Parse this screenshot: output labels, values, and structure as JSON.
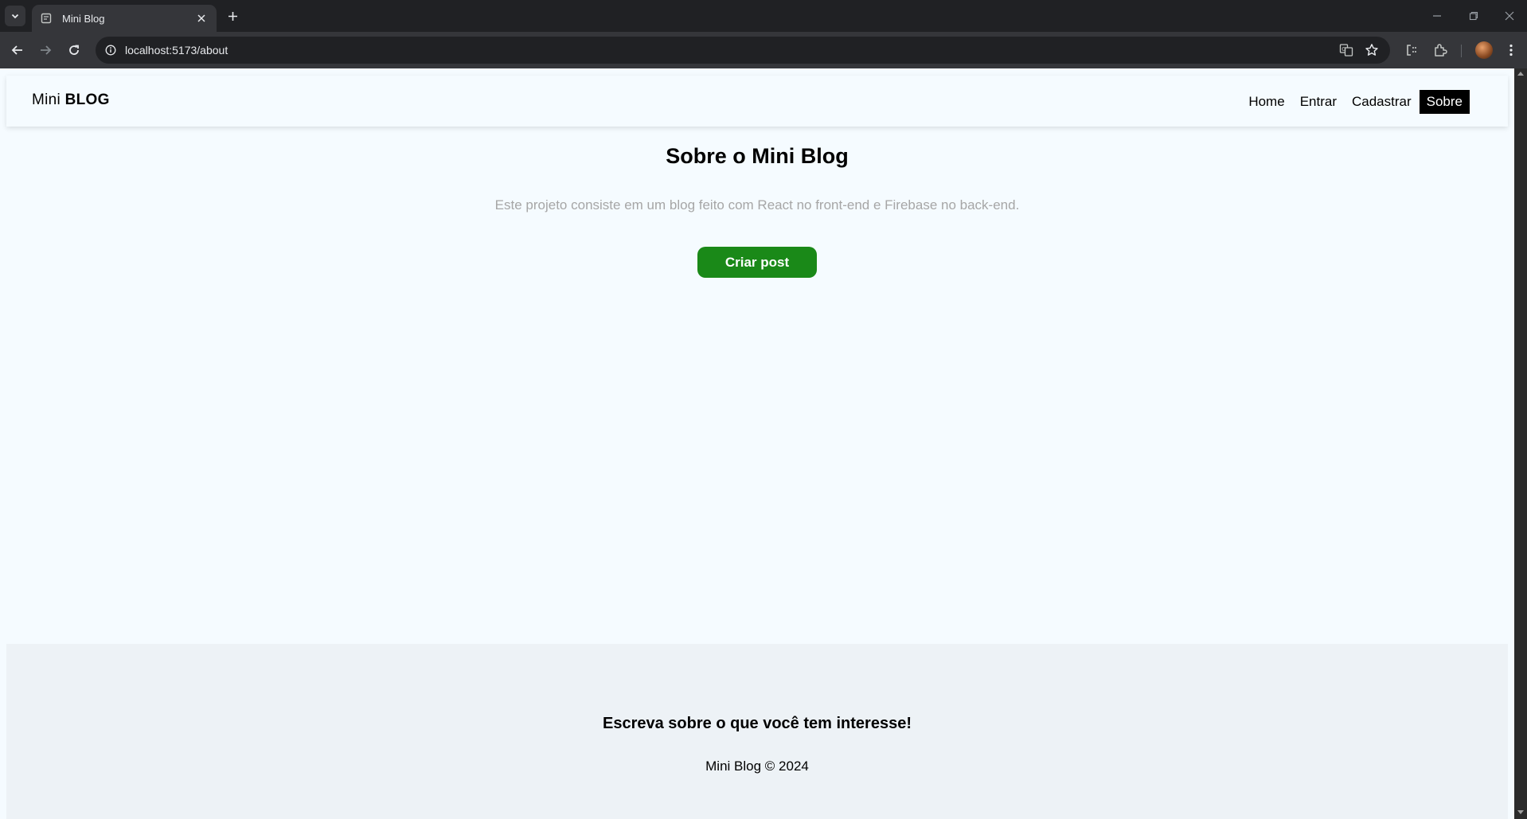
{
  "browser": {
    "tab_title": "Mini Blog",
    "url": "localhost:5173/about"
  },
  "site": {
    "brand_prefix": "Mini ",
    "brand_bold": "BLOG",
    "nav": [
      {
        "label": "Home",
        "active": false
      },
      {
        "label": "Entrar",
        "active": false
      },
      {
        "label": "Cadastrar",
        "active": false
      },
      {
        "label": "Sobre",
        "active": true
      }
    ]
  },
  "about": {
    "title": "Sobre o Mini Blog",
    "description": "Este projeto consiste em um blog feito com React no front-end e Firebase no back-end.",
    "cta_label": "Criar post"
  },
  "footer": {
    "title": "Escreva sobre o que você tem interesse!",
    "copyright": "Mini Blog © 2024"
  },
  "colors": {
    "page_bg": "#f5fbff",
    "footer_bg": "#edf2f6",
    "accent_green": "#1a8918",
    "active_nav_bg": "#000000",
    "muted_text": "#a6a6a6"
  }
}
